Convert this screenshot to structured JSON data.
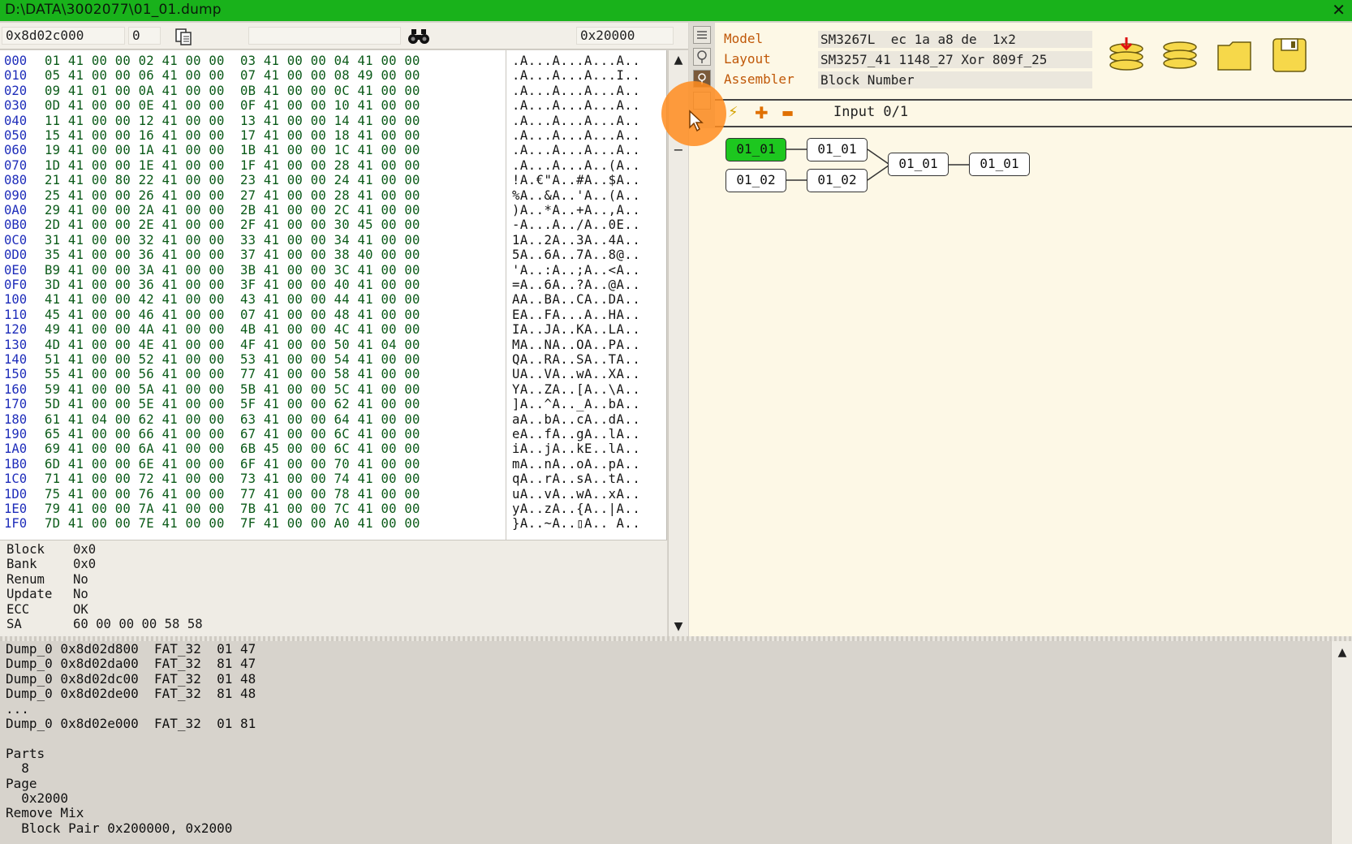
{
  "window": {
    "title": "D:\\DATA\\3002077\\01_01.dump",
    "close_glyph": "✕"
  },
  "left_toolbar": {
    "address": "0x8d02c000",
    "block_index": "0",
    "search_value": "",
    "size": "0x20000",
    "copy_icon": "copy-icon",
    "find_icon": "binoculars-icon"
  },
  "hex": {
    "rows": [
      {
        "off": "000",
        "bytes": "01 41 00 00 02 41 00 00  03 41 00 00 04 41 00 00",
        "ascii": ".A...A...A...A.."
      },
      {
        "off": "010",
        "bytes": "05 41 00 00 06 41 00 00  07 41 00 00 08 49 00 00",
        "ascii": ".A...A...A...I.."
      },
      {
        "off": "020",
        "bytes": "09 41 01 00 0A 41 00 00  0B 41 00 00 0C 41 00 00",
        "ascii": ".A...A...A...A.."
      },
      {
        "off": "030",
        "bytes": "0D 41 00 00 0E 41 00 00  0F 41 00 00 10 41 00 00",
        "ascii": ".A...A...A...A.."
      },
      {
        "off": "040",
        "bytes": "11 41 00 00 12 41 00 00  13 41 00 00 14 41 00 00",
        "ascii": ".A...A...A...A.."
      },
      {
        "off": "050",
        "bytes": "15 41 00 00 16 41 00 00  17 41 00 00 18 41 00 00",
        "ascii": ".A...A...A...A.."
      },
      {
        "off": "060",
        "bytes": "19 41 00 00 1A 41 00 00  1B 41 00 00 1C 41 00 00",
        "ascii": ".A...A...A...A.."
      },
      {
        "off": "070",
        "bytes": "1D 41 00 00 1E 41 00 00  1F 41 00 00 28 41 00 00",
        "ascii": ".A...A...A..(A.."
      },
      {
        "off": "080",
        "bytes": "21 41 00 80 22 41 00 00  23 41 00 00 24 41 00 00",
        "ascii": "!A.€\"A..#A..$A.."
      },
      {
        "off": "090",
        "bytes": "25 41 00 00 26 41 00 00  27 41 00 00 28 41 00 00",
        "ascii": "%A..&A..'A..(A.."
      },
      {
        "off": "0A0",
        "bytes": "29 41 00 00 2A 41 00 00  2B 41 00 00 2C 41 00 00",
        "ascii": ")A..*A..+A..,A.."
      },
      {
        "off": "0B0",
        "bytes": "2D 41 00 00 2E 41 00 00  2F 41 00 00 30 45 00 00",
        "ascii": "-A...A../A..0E.."
      },
      {
        "off": "0C0",
        "bytes": "31 41 00 00 32 41 00 00  33 41 00 00 34 41 00 00",
        "ascii": "1A..2A..3A..4A.."
      },
      {
        "off": "0D0",
        "bytes": "35 41 00 00 36 41 00 00  37 41 00 00 38 40 00 00",
        "ascii": "5A..6A..7A..8@.."
      },
      {
        "off": "0E0",
        "bytes": "B9 41 00 00 3A 41 00 00  3B 41 00 00 3C 41 00 00",
        "ascii": "'A..:A..;A..<A.."
      },
      {
        "off": "0F0",
        "bytes": "3D 41 00 00 36 41 00 00  3F 41 00 00 40 41 00 00",
        "ascii": "=A..6A..?A..@A.."
      },
      {
        "off": "100",
        "bytes": "41 41 00 00 42 41 00 00  43 41 00 00 44 41 00 00",
        "ascii": "AA..BA..CA..DA.."
      },
      {
        "off": "110",
        "bytes": "45 41 00 00 46 41 00 00  07 41 00 00 48 41 00 00",
        "ascii": "EA..FA...A..HA.."
      },
      {
        "off": "120",
        "bytes": "49 41 00 00 4A 41 00 00  4B 41 00 00 4C 41 00 00",
        "ascii": "IA..JA..KA..LA.."
      },
      {
        "off": "130",
        "bytes": "4D 41 00 00 4E 41 00 00  4F 41 00 00 50 41 04 00",
        "ascii": "MA..NA..OA..PA.."
      },
      {
        "off": "140",
        "bytes": "51 41 00 00 52 41 00 00  53 41 00 00 54 41 00 00",
        "ascii": "QA..RA..SA..TA.."
      },
      {
        "off": "150",
        "bytes": "55 41 00 00 56 41 00 00  77 41 00 00 58 41 00 00",
        "ascii": "UA..VA..wA..XA.."
      },
      {
        "off": "160",
        "bytes": "59 41 00 00 5A 41 00 00  5B 41 00 00 5C 41 00 00",
        "ascii": "YA..ZA..[A..\\A.."
      },
      {
        "off": "170",
        "bytes": "5D 41 00 00 5E 41 00 00  5F 41 00 00 62 41 00 00",
        "ascii": "]A..^A.._A..bA.."
      },
      {
        "off": "180",
        "bytes": "61 41 04 00 62 41 00 00  63 41 00 00 64 41 00 00",
        "ascii": "aA..bA..cA..dA.."
      },
      {
        "off": "190",
        "bytes": "65 41 00 00 66 41 00 00  67 41 00 00 6C 41 00 00",
        "ascii": "eA..fA..gA..lA.."
      },
      {
        "off": "1A0",
        "bytes": "69 41 00 00 6A 41 00 00  6B 45 00 00 6C 41 00 00",
        "ascii": "iA..jA..kE..lA.."
      },
      {
        "off": "1B0",
        "bytes": "6D 41 00 00 6E 41 00 00  6F 41 00 00 70 41 00 00",
        "ascii": "mA..nA..oA..pA.."
      },
      {
        "off": "1C0",
        "bytes": "71 41 00 00 72 41 00 00  73 41 00 00 74 41 00 00",
        "ascii": "qA..rA..sA..tA.."
      },
      {
        "off": "1D0",
        "bytes": "75 41 00 00 76 41 00 00  77 41 00 00 78 41 00 00",
        "ascii": "uA..vA..wA..xA.."
      },
      {
        "off": "1E0",
        "bytes": "79 41 00 00 7A 41 00 00  7B 41 00 00 7C 41 00 00",
        "ascii": "yA..zA..{A..|A.."
      },
      {
        "off": "1F0",
        "bytes": "7D 41 00 00 7E 41 00 00  7F 41 00 00 A0 41 00 00",
        "ascii": "}A..~A..▯A.. A.."
      }
    ]
  },
  "info": {
    "rows": [
      {
        "k": "Block",
        "v": "0x0"
      },
      {
        "k": "Bank",
        "v": "0x0"
      },
      {
        "k": "Renum",
        "v": "No"
      },
      {
        "k": "Update",
        "v": "No"
      },
      {
        "k": "ECC",
        "v": "OK"
      },
      {
        "k": "SA",
        "v": "60 00 00 00 58 58"
      }
    ]
  },
  "scrollbar": {
    "up": "▲",
    "down": "▼",
    "minus": "−"
  },
  "properties": {
    "model_label": "Model",
    "model_value": "SM3267L  ec 1a a8 de  1x2",
    "layout_label": "Layout",
    "layout_value": "SM3257_41 1148_27 Xor 809f_25",
    "assembler_label": "Assembler",
    "assembler_value": "Block Number"
  },
  "input_bar": {
    "label": "Input 0/1",
    "plus": "✚",
    "minus": "▬",
    "bolt": "⚡"
  },
  "tree": {
    "nodes": [
      "01_01",
      "01_01",
      "01_02",
      "01_02",
      "01_01",
      "01_01"
    ]
  },
  "log": {
    "lines": [
      "Dump_0 0x8d02d800  FAT_32  01 47",
      "Dump_0 0x8d02da00  FAT_32  81 47",
      "Dump_0 0x8d02dc00  FAT_32  01 48",
      "Dump_0 0x8d02de00  FAT_32  81 48",
      "...",
      "Dump_0 0x8d02e000  FAT_32  01 81",
      "",
      "Parts",
      "  8",
      "Page",
      "  0x2000",
      "Remove Mix",
      "  Block Pair 0x200000, 0x2000"
    ]
  },
  "colors": {
    "title_green": "#19b21b",
    "node_active": "#1dc71f",
    "label_orange": "#c05808",
    "hex_offset_blue": "#1e2dba",
    "hex_byte_green": "#0a5a18"
  }
}
